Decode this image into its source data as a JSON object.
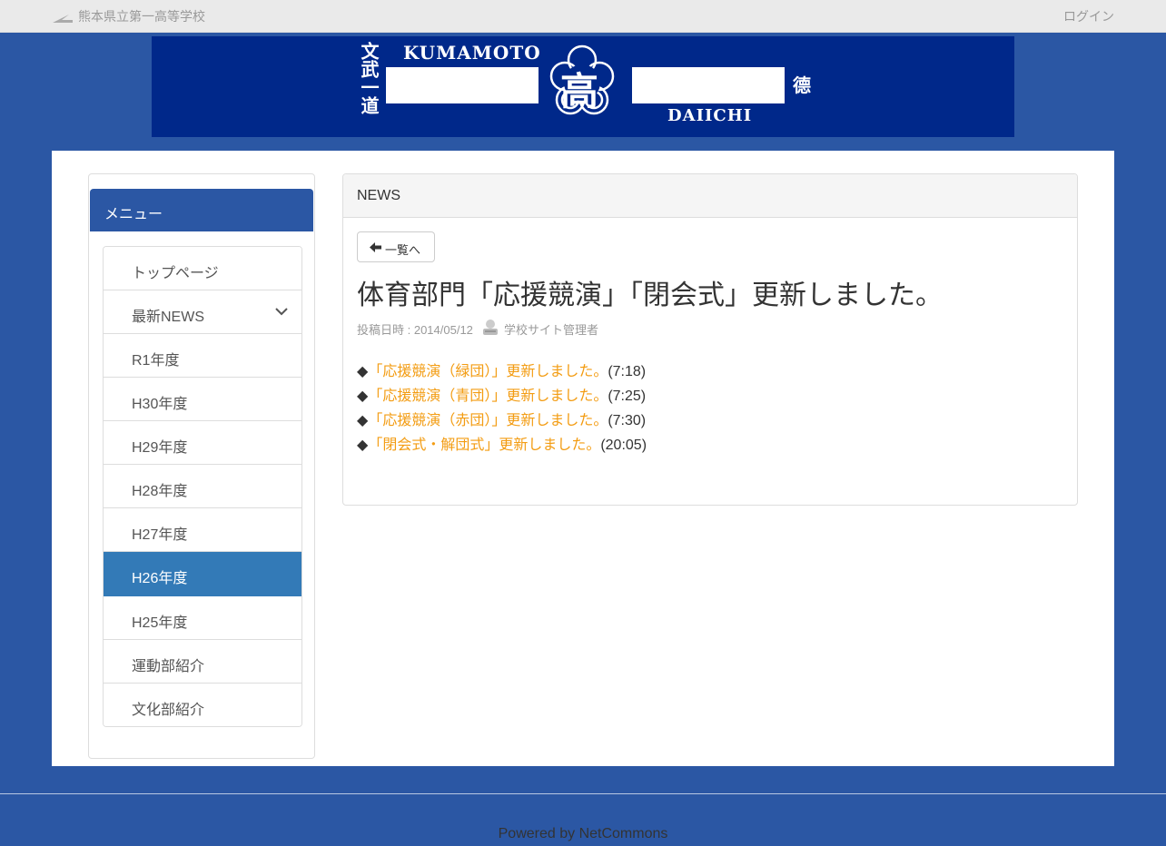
{
  "topbar": {
    "site_name": "熊本県立第一高等学校",
    "login_label": "ログイン"
  },
  "banner": {
    "kumamoto": "KUMAMOTO",
    "daiichi": "DAIICHI",
    "crest_char": "高",
    "left_vertical": "文武一道",
    "right_char": "德"
  },
  "menu": {
    "heading": "メニュー",
    "items": [
      {
        "label": "トップページ"
      },
      {
        "label": "最新NEWS",
        "expandable": true
      },
      {
        "label": "R1年度"
      },
      {
        "label": "H30年度"
      },
      {
        "label": "H29年度"
      },
      {
        "label": "H28年度"
      },
      {
        "label": "H27年度"
      },
      {
        "label": "H26年度",
        "active": true
      },
      {
        "label": "H25年度"
      },
      {
        "label": "運動部紹介"
      },
      {
        "label": "文化部紹介"
      }
    ]
  },
  "news": {
    "panel_title": "NEWS",
    "back_label": "一覧へ",
    "title": "体育部門「応援競演」「閉会式」更新しました。",
    "posted_label": "投稿日時 : 2014/05/12",
    "author": "学校サイト管理者",
    "lines": [
      {
        "bullet": "◆",
        "link": "「応援競演（緑団）」更新しました。",
        "time": "(7:18)"
      },
      {
        "bullet": "◆",
        "link": "「応援競演（青団）」更新しました。",
        "time": "(7:25)"
      },
      {
        "bullet": "◆",
        "link": "「応援競演（赤団）」更新しました。",
        "time": "(7:30)"
      },
      {
        "bullet": "◆",
        "link": "「閉会式・解団式」更新しました。",
        "time": "(20:05)"
      }
    ]
  },
  "footer": {
    "powered_prefix": "Powered by ",
    "powered_link": "NetCommons"
  },
  "colors": {
    "page_bg": "#2b57a4",
    "banner_bg": "#00288a",
    "active_item": "#337ab7",
    "link": "#f39c12"
  }
}
